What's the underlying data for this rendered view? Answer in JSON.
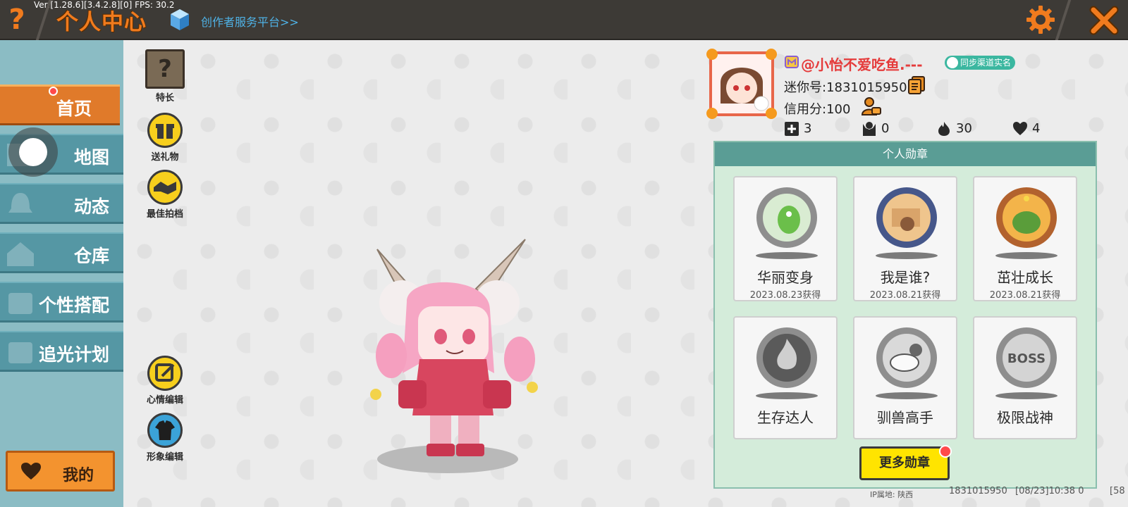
{
  "topbar": {
    "version": "Ver:[1.28.6][3.4.2.8][0] FPS: 30.2",
    "title": "个人中心",
    "help_label": "?",
    "platform_link": "创作者服务平台>>"
  },
  "sidebar": {
    "items": [
      {
        "label": "首页",
        "active": true
      },
      {
        "label": "地图"
      },
      {
        "label": "动态"
      },
      {
        "label": "仓库"
      },
      {
        "label": "个性搭配"
      },
      {
        "label": "追光计划"
      }
    ],
    "my_button": "我的"
  },
  "actions": {
    "specialty": "特长",
    "specialty_glyph": "?",
    "send_gift": "送礼物",
    "best_partner": "最佳拍档",
    "mood_edit": "心情编辑",
    "avatar_edit": "形象编辑"
  },
  "profile": {
    "nickname": "@小怡不爱吃鱼.---",
    "sync_label": "同步渠道实名",
    "mini_id": "迷你号:1831015950",
    "credit": "信用分:100",
    "stats": {
      "likes": "3",
      "followers": "0",
      "popularity": "30",
      "hearts": "4"
    }
  },
  "medals": {
    "title": "个人勋章",
    "items": [
      {
        "name": "华丽变身",
        "date": "2023.08.23获得"
      },
      {
        "name": "我是谁?",
        "date": "2023.08.21获得"
      },
      {
        "name": "茁壮成长",
        "date": "2023.08.21获得"
      },
      {
        "name": "生存达人",
        "date": ""
      },
      {
        "name": "驯兽高手",
        "date": ""
      },
      {
        "name": "极限战神",
        "date": ""
      }
    ],
    "more_label": "更多勋章"
  },
  "footer": {
    "ip": "IP属地: 陕西",
    "uid": "1831015950",
    "time": "[08/23]10:38 0",
    "extra": "[58"
  },
  "colors": {
    "accent_orange": "#f07b1e",
    "sidebar_teal": "#5597a4",
    "medal_panel_bg": "#d4ecda",
    "nickname_red": "#e53b3b",
    "yellow_button": "#ffe400"
  }
}
